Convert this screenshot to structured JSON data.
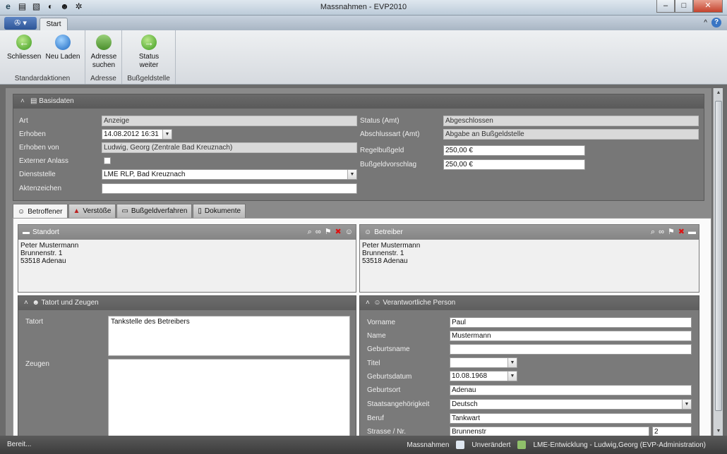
{
  "window": {
    "title": "Massnahmen - EVP2010",
    "min": "–",
    "max": "□",
    "close": "✕"
  },
  "ribbon": {
    "tab_start": "Start",
    "collapse": "^",
    "help": "?",
    "groups": {
      "std": {
        "label": "Standardaktionen",
        "close": "Schliessen",
        "reload": "Neu Laden"
      },
      "adr": {
        "label": "Adresse",
        "search_l1": "Adresse",
        "search_l2": "suchen"
      },
      "bus": {
        "label": "Bußgeldstelle",
        "status_l1": "Status",
        "status_l2": "weiter"
      }
    }
  },
  "basis": {
    "title": "Basisdaten",
    "art_label": "Art",
    "art": "Anzeige",
    "erhoben_label": "Erhoben",
    "erhoben": "14.08.2012 16:31",
    "erhoben_von_label": "Erhoben von",
    "erhoben_von": "Ludwig, Georg (Zentrale Bad Kreuznach)",
    "extern_label": "Externer Anlass",
    "dienst_label": "Dienststelle",
    "dienst": "LME RLP, Bad Kreuznach",
    "akten_label": "Aktenzeichen",
    "akten": "",
    "status_label": "Status (Amt)",
    "status": "Abgeschlossen",
    "abschluss_label": "Abschlussart (Amt)",
    "abschluss": "Abgabe an Bußgeldstelle",
    "regel_label": "Regelbußgeld",
    "regel": "250,00 €",
    "vorschlag_label": "Bußgeldvorschlag",
    "vorschlag": "250,00 €"
  },
  "tabs": [
    "Betroffener",
    "Verstöße",
    "Bußgeldverfahren",
    "Dokumente"
  ],
  "standort": {
    "title": "Standort",
    "l1": "Peter Mustermann",
    "l2": "Brunnenstr. 1",
    "l3": "53518 Adenau"
  },
  "betreiber": {
    "title": "Betreiber",
    "l1": "Peter Mustermann",
    "l2": "Brunnenstr. 1",
    "l3": "53518 Adenau"
  },
  "tatort": {
    "title": "Tatort und Zeugen",
    "tatort_label": "Tatort",
    "tatort": "Tankstelle des Betreibers",
    "zeugen_label": "Zeugen",
    "zeugen": ""
  },
  "person": {
    "title": "Verantwortliche Person",
    "vorname_label": "Vorname",
    "vorname": "Paul",
    "name_label": "Name",
    "name": "Mustermann",
    "geburtsname_label": "Geburtsname",
    "geburtsname": "",
    "titel_label": "Titel",
    "titel": "",
    "geburtsdatum_label": "Geburtsdatum",
    "geburtsdatum": "10.08.1968",
    "geburtsort_label": "Geburtsort",
    "geburtsort": "Adenau",
    "staat_label": "Staatsangehörigkeit",
    "staat": "Deutsch",
    "beruf_label": "Beruf",
    "beruf": "Tankwart",
    "strasse_label": "Strasse / Nr.",
    "strasse": "Brunnenstr",
    "nr": "2"
  },
  "status": {
    "left": "Bereit...",
    "modul": "Massnahmen",
    "state": "Unverändert",
    "env": "LME-Entwicklung - Ludwig,Georg (EVP-Administration)"
  }
}
